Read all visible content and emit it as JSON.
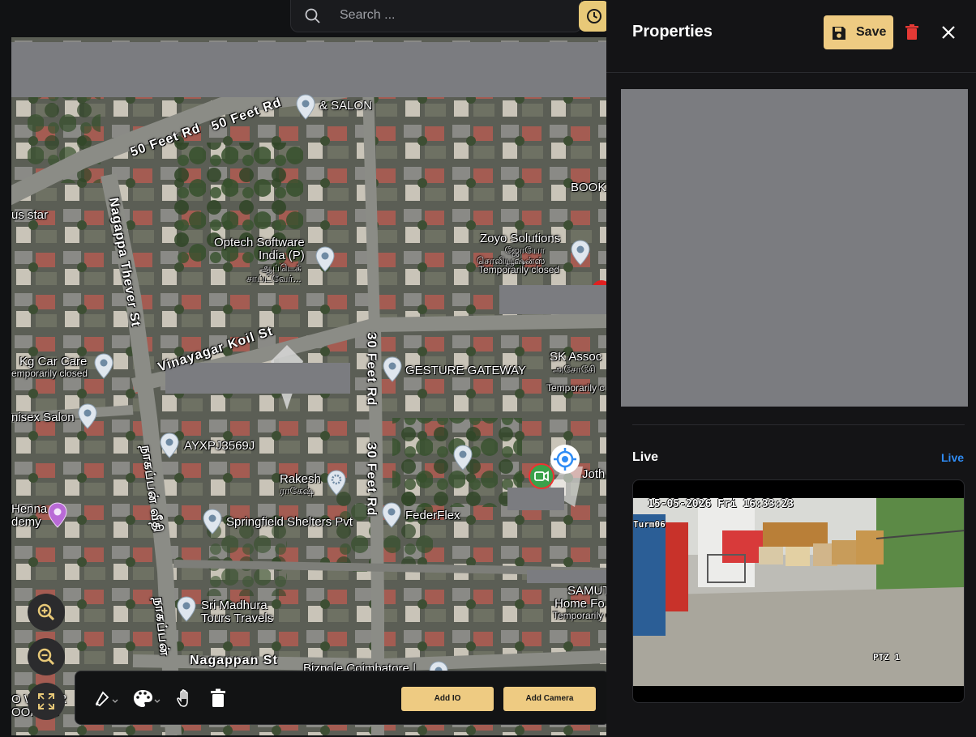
{
  "search": {
    "placeholder": "Search ..."
  },
  "map": {
    "labels": {
      "salon_top": "& SALON",
      "road_50ft_a": "50 Feet Rd",
      "road_50ft_b": "50 Feet Rd",
      "book": "BOOK",
      "us_star": "us star",
      "nagappa_thever": "Nagappa Thever St",
      "optech": "Optech Software\nIndia (P)",
      "optech_ta": "ஆப்டெக்\nசாப்ட்வேர்...",
      "zoyo": "Zoyo Solutions",
      "zoyo_ta": "ஜோயோ\nசொலியூஷன்ஸ்",
      "zoyo_status": "Temporarily closed",
      "vinayagar": "Vinayagar Koil St",
      "road_30ft_a": "30 Feet Rd",
      "road_30ft_b": "30 Feet Rd",
      "kg_car": "Kg Car Care",
      "kg_status": "emporarily closed",
      "gesture": "GESTURE GATEWAY",
      "sk": "SK Assoc",
      "sk_ta": "அசோசிே",
      "sk_status": "Temporarily c",
      "unisex": "nisex Salon",
      "ayxpj": "AYXPJ3569J",
      "rakesh": "Rakesh",
      "rakesh_ta": "ராகேஷ்",
      "joth": "Joth",
      "henna": "Henna\ndemy",
      "springfield": "Springfield Shelters Pvt",
      "federflex": "FederFlex",
      "nagappan_ta": "நாகப்பன் வீதி",
      "nagappan_ta2": "நாகப்பன்",
      "sri_madhura": "Sri Madhura\nTours Travels",
      "samut": "SAMUT",
      "home_fo": "Home Fo",
      "samut_status": "Temporarily cl",
      "nagappan": "Nagappan St",
      "bizpole": "Bizpole Coimbatore |",
      "waterproofing": "O WATER\nOOFING"
    }
  },
  "toolbar": {
    "add_io": "Add IO",
    "add_camera": "Add Camera"
  },
  "panel": {
    "title": "Properties",
    "save": "Save",
    "live_title": "Live",
    "live_link": "Live"
  },
  "video": {
    "timestamp": "15-05-2026 Fri 16:33:23",
    "camera_name": "Turm06",
    "ptz": "PTZ 1"
  },
  "colors": {
    "accent": "#eecb82",
    "link": "#2f8cf5",
    "delete": "#e53935"
  }
}
